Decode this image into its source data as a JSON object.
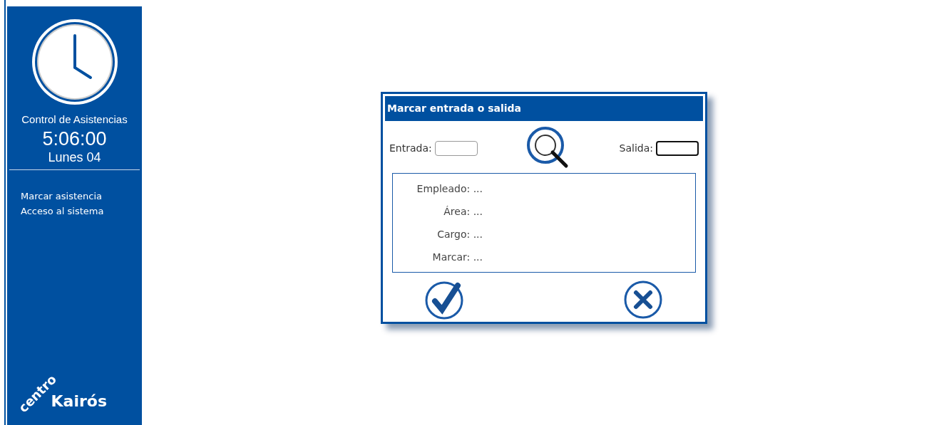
{
  "sidebar": {
    "title": "Control de Asistencias",
    "time": "5:06:00",
    "date": "Lunes 04",
    "menu": [
      {
        "label": "Marcar asistencia"
      },
      {
        "label": "Acceso al sistema"
      }
    ],
    "logo": {
      "word_1": "centro",
      "word_2": "Kairós"
    }
  },
  "dialog": {
    "title": "Marcar entrada o salida",
    "fields": [
      {
        "label": "Entrada:",
        "focused": false
      },
      {
        "label": "Salida:",
        "focused": true
      }
    ],
    "info": [
      "Empleado: ...",
      "Área: ...",
      "Cargo: ...",
      "Marcar: ..."
    ]
  }
}
